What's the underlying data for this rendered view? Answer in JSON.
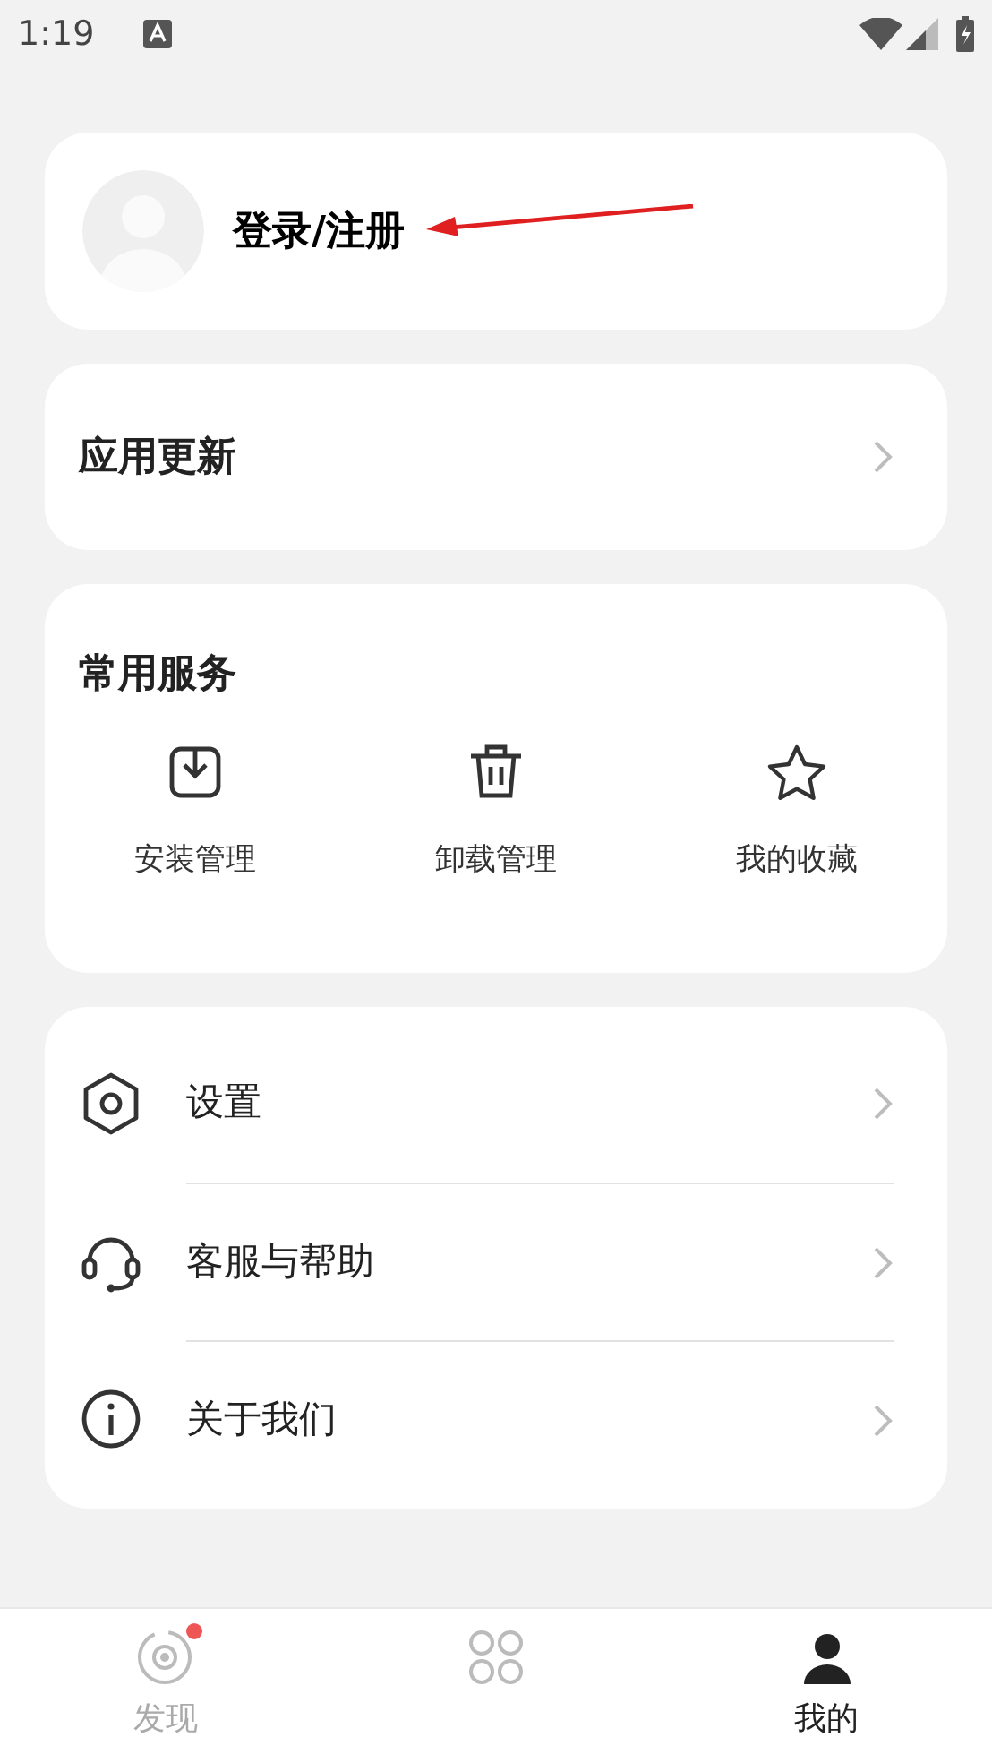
{
  "status_bar": {
    "time": "1:19"
  },
  "profile": {
    "label": "登录/注册"
  },
  "update_row": {
    "label": "应用更新"
  },
  "services": {
    "title": "常用服务",
    "items": [
      {
        "kind": "install",
        "label": "安装管理"
      },
      {
        "kind": "uninstall",
        "label": "卸载管理"
      },
      {
        "kind": "favorite",
        "label": "我的收藏"
      }
    ]
  },
  "menu": [
    {
      "kind": "settings",
      "label": "设置"
    },
    {
      "kind": "support",
      "label": "客服与帮助"
    },
    {
      "kind": "about",
      "label": "关于我们"
    }
  ],
  "bottom_nav": [
    {
      "kind": "discover",
      "label": "发现",
      "selected": false,
      "badge": true
    },
    {
      "kind": "apps",
      "selected": false,
      "badge": false
    },
    {
      "kind": "me",
      "label": "我的",
      "selected": true,
      "badge": false
    }
  ]
}
